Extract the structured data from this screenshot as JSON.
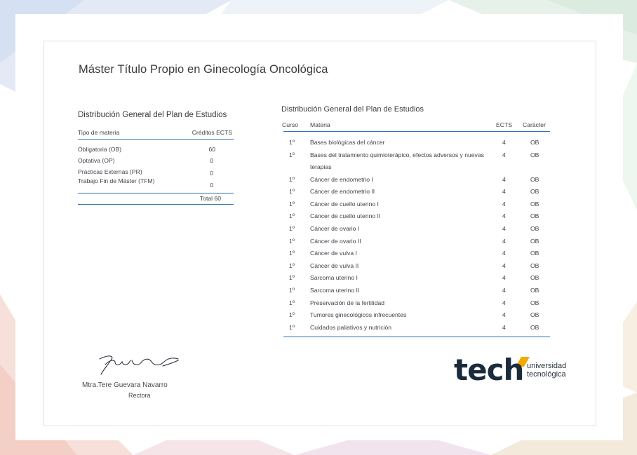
{
  "certificate": {
    "title": "Máster Título Propio en Ginecología Oncológica"
  },
  "left_table": {
    "title": "Distribución General del Plan de Estudios",
    "headers": [
      "Tipo de materia",
      "Créditos ECTS"
    ],
    "rows": [
      {
        "tipo": "Obligatoria (OB)",
        "creditos": "60"
      },
      {
        "tipo": "Optativa (OP)",
        "creditos": "0"
      },
      {
        "tipo": "Prácticas Externas (PR)",
        "creditos": "0"
      },
      {
        "tipo": "Trabajo Fin de Máster (TFM)",
        "creditos": "0"
      }
    ],
    "total": "Total 60"
  },
  "right_table": {
    "title": "Distribución General del Plan de Estudios",
    "headers": [
      "Curso",
      "Materia",
      "ECTS",
      "Carácter"
    ],
    "rows": [
      {
        "curso": "1º",
        "materia": "Bases biológicas del cáncer",
        "ects": "4",
        "caracter": "OB"
      },
      {
        "curso": "1º",
        "materia": "Bases del tratamiento quimioterápico, efectos adversos y nuevas terapias",
        "ects": "4",
        "caracter": "OB"
      },
      {
        "curso": "1º",
        "materia": "Cáncer de endometrio I",
        "ects": "4",
        "caracter": "OB"
      },
      {
        "curso": "1º",
        "materia": "Cáncer de endometrio II",
        "ects": "4",
        "caracter": "OB"
      },
      {
        "curso": "1º",
        "materia": "Cáncer de cuello uterino I",
        "ects": "4",
        "caracter": "OB"
      },
      {
        "curso": "1º",
        "materia": "Cáncer de cuello uterino II",
        "ects": "4",
        "caracter": "OB"
      },
      {
        "curso": "1º",
        "materia": "Cáncer de ovario I",
        "ects": "4",
        "caracter": "OB"
      },
      {
        "curso": "1º",
        "materia": "Cáncer de ovario II",
        "ects": "4",
        "caracter": "OB"
      },
      {
        "curso": "1º",
        "materia": "Cáncer de vulva I",
        "ects": "4",
        "caracter": "OB"
      },
      {
        "curso": "1º",
        "materia": "Cáncer de vulva II",
        "ects": "4",
        "caracter": "OB"
      },
      {
        "curso": "1º",
        "materia": "Sarcoma uterino I",
        "ects": "4",
        "caracter": "OB"
      },
      {
        "curso": "1º",
        "materia": "Sarcoma uterino II",
        "ects": "4",
        "caracter": "OB"
      },
      {
        "curso": "1º",
        "materia": "Preservación de la fertilidad",
        "ects": "4",
        "caracter": "OB"
      },
      {
        "curso": "1º",
        "materia": "Tumores ginecológicos infrecuentes",
        "ects": "4",
        "caracter": "OB"
      },
      {
        "curso": "1º",
        "materia": "Cuidados paliativos y nutrición",
        "ects": "4",
        "caracter": "OB"
      }
    ]
  },
  "signature": {
    "name": "Mtra.Tere Guevara Navarro",
    "role": "Rectora"
  },
  "logo": {
    "word": "tech",
    "line1": "universidad",
    "line2": "tecnológica",
    "accent_color": "#f5a800"
  },
  "colors": {
    "rule": "#2e72b8",
    "text": "#3e4248"
  }
}
